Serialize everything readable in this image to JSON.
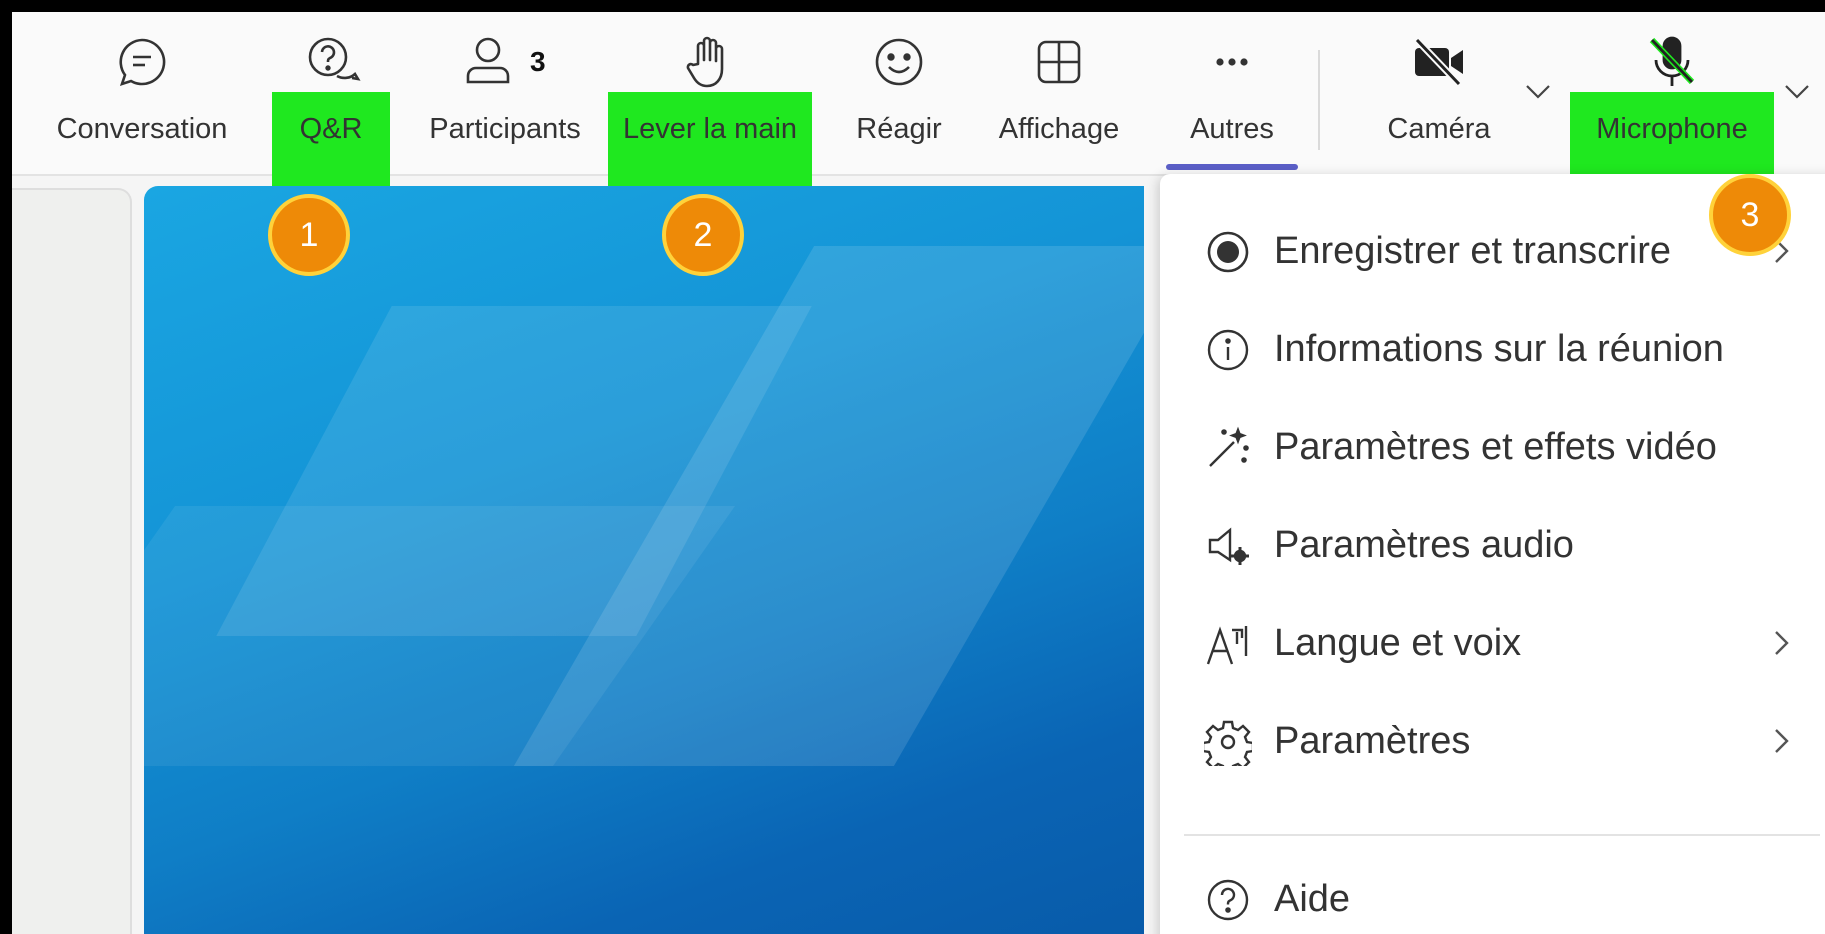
{
  "toolbar": {
    "conversation": "Conversation",
    "qa": "Q&R",
    "participants": "Participants",
    "participants_count": "3",
    "raise_hand": "Lever la main",
    "react": "Réagir",
    "view": "Affichage",
    "more": "Autres",
    "camera": "Caméra",
    "microphone": "Microphone"
  },
  "highlight_color": "#1fe81f",
  "accent_color": "#5b5fc7",
  "markers": [
    "1",
    "2",
    "3"
  ],
  "menu": {
    "items": [
      {
        "label": "Enregistrer et transcrire",
        "icon": "record-icon"
      },
      {
        "label": "Informations sur la réunion",
        "icon": "info-icon"
      },
      {
        "label": "Paramètres et effets vidéo",
        "icon": "magic-wand-icon"
      },
      {
        "label": "Paramètres audio",
        "icon": "speaker-settings-icon"
      },
      {
        "label": "Langue et voix",
        "icon": "language-icon"
      },
      {
        "label": "Paramètres",
        "icon": "gear-icon"
      },
      {
        "label": "Aide",
        "icon": "help-icon"
      }
    ]
  }
}
